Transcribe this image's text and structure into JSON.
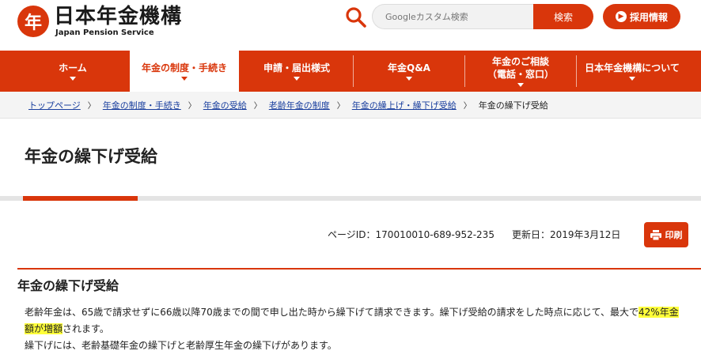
{
  "header": {
    "logo_mark": "年",
    "logo_name": "日本年金機構",
    "logo_sub": "Japan Pension Service",
    "search_placeholder": "Googleカスタム検索",
    "search_button": "検索",
    "recruit_button": "採用情報"
  },
  "nav": {
    "items": [
      {
        "line1": "ホーム",
        "line2": ""
      },
      {
        "line1": "年金の制度・手続き",
        "line2": ""
      },
      {
        "line1": "申請・届出様式",
        "line2": ""
      },
      {
        "line1": "年金Q&A",
        "line2": ""
      },
      {
        "line1": "年金のご相談",
        "line2": "（電話・窓口）"
      },
      {
        "line1": "日本年金機構について",
        "line2": ""
      }
    ]
  },
  "breadcrumb": {
    "items": [
      "トップページ",
      "年金の制度・手続き",
      "年金の受給",
      "老齢年金の制度",
      "年金の繰上げ・繰下げ受給"
    ],
    "current": "年金の繰下げ受給",
    "separator": "〉"
  },
  "page": {
    "title": "年金の繰下げ受給",
    "page_id": "ページID：170010010-689-952-235",
    "updated": "更新日：2019年3月12日",
    "print_label": "印刷"
  },
  "section": {
    "heading": "年金の繰下げ受給",
    "para1_a": "老齢年金は、65歳で請求せずに66歳以降70歳までの間で申し出た時から繰下げて請求できます。繰下げ受給の請求をした時点に応じて、最大で",
    "para1_highlight": "42%年金額が増額",
    "para1_b": "されます。",
    "para2": "繰下げには、老齢基礎年金の繰下げと老齢厚生年金の繰下げがあります。"
  },
  "colors": {
    "accent": "#d9360b",
    "link": "#1a3f9e",
    "highlight": "#ffff3a"
  }
}
